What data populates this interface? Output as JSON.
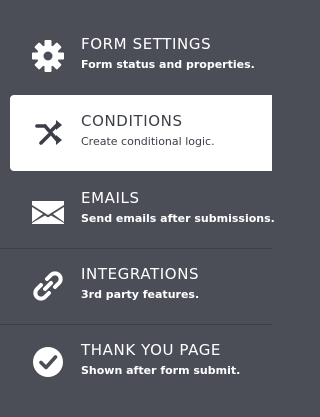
{
  "menu": {
    "items": [
      {
        "title": "FORM SETTINGS",
        "subtitle": "Form status and properties.",
        "icon": "gear-icon"
      },
      {
        "title": "CONDITIONS",
        "subtitle": "Create conditional logic.",
        "icon": "conditions-icon"
      },
      {
        "title": "EMAILS",
        "subtitle": "Send emails after submissions.",
        "icon": "envelope-icon"
      },
      {
        "title": "INTEGRATIONS",
        "subtitle": "3rd party features.",
        "icon": "link-icon"
      },
      {
        "title": "THANK YOU PAGE",
        "subtitle": "Shown after form submit.",
        "icon": "check-circle-icon"
      }
    ],
    "active_index": 1
  },
  "colors": {
    "background": "#4b4e57",
    "active_background": "#ffffff",
    "text": "#ffffff",
    "active_text": "#3b3e47"
  }
}
